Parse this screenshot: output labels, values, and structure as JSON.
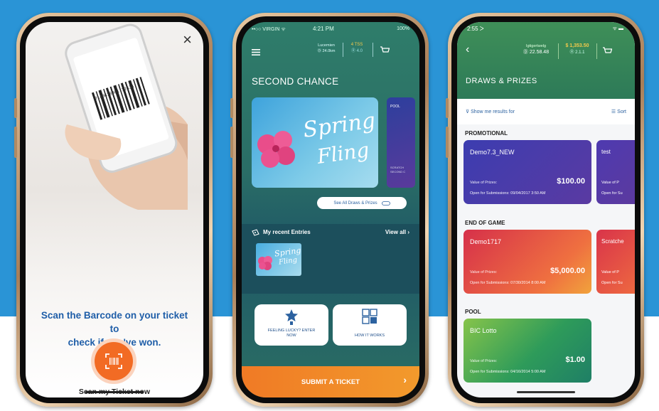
{
  "colors": {
    "background_blue": "#2a94d6",
    "accent_orange": "#f26b24",
    "teal": "#2a6d66",
    "promo_card": "#4a3aa8",
    "end_of_game_card": "#e0453a",
    "pool_card": "#2e9b5a"
  },
  "phone1": {
    "close_icon": "×",
    "barcode_digits": "7140678901  12634",
    "scan_text_line1": "Scan the Barcode on your ticket to",
    "scan_text_line2": "check if you've won.",
    "scan_button_icon": "barcode-scan-icon",
    "scan_label": "Scan my Ticket now"
  },
  "phone2": {
    "status": {
      "carrier": "••○○ VIRGIN ᯤ",
      "time": "4:21 PM",
      "battery": "100%"
    },
    "header": {
      "label1": "Lucemien",
      "value1": "Ⓓ 24.0km",
      "value2": "4 TSS",
      "sub2": "Ⓡ 4.0"
    },
    "section_title": "SECOND CHANCE",
    "featured_card": {
      "word1": "Spring",
      "word2": "Fling"
    },
    "side_card": {
      "label": "POOL",
      "foot1": "SCRATCH",
      "foot2": "SECOND C"
    },
    "see_all": "See All Draws & Prizes",
    "recent_title": "My recent Entries",
    "view_all": "View all",
    "recent_thumb": {
      "word1": "Spring",
      "word2": "Fling"
    },
    "tile1": {
      "line1": "FEELING LUCKY? ENTER",
      "line2": "NOW"
    },
    "tile2": {
      "line1": "HOW IT WORKS"
    },
    "submit_label": "SUBMIT A TICKET"
  },
  "phone3": {
    "status": {
      "time": "2:55 ᐳ",
      "right": "ᯤ ▬"
    },
    "header": {
      "label": "Igtigertwelg",
      "value1": "Ⓓ 22.58.48",
      "money": "$ 1,353.50",
      "sub": "Ⓡ 2.1.1"
    },
    "title": "DRAWS & PRIZES",
    "filter_label": "Show me results for",
    "sort_label": "Sort",
    "sections": {
      "promotional": "PROMOTIONAL",
      "end_of_game": "END OF GAME",
      "pool": "POOL"
    },
    "cards": {
      "promo_main": {
        "name": "Demo7.3_NEW",
        "value_label": "Value of Prizes:",
        "amount": "$100.00",
        "open_label": "Open for Submissions:",
        "open_date": "09/04/2017 3:50 AM"
      },
      "promo_side": {
        "name": "test",
        "value_label": "Value of P",
        "open_label": "Open for Su"
      },
      "eog_main": {
        "name": "Demo1717",
        "value_label": "Value of Prizes:",
        "amount": "$5,000.00",
        "open_label": "Open for Submissions:",
        "open_date": "07/30/2014 8:00 AM"
      },
      "eog_side": {
        "name": "Scratche",
        "value_label": "Value of P",
        "open_label": "Open for Su"
      },
      "pool_main": {
        "name": "BIC Lotto",
        "value_label": "Value of Prizes:",
        "amount": "$1.00",
        "open_label": "Open for Submissions:",
        "open_date": "04/16/2014 5:00 AM"
      }
    }
  }
}
